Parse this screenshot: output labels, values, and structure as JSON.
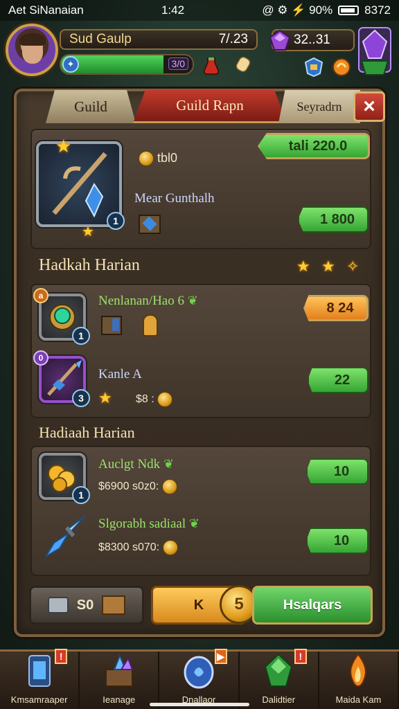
{
  "status_bar": {
    "left": "Aet SiNanaian",
    "time": "1:42",
    "right": "@ ⚙ ⚡ 90%",
    "extra": "8372"
  },
  "player": {
    "name": "Sud Gaulp",
    "score": "7/.23",
    "level": "3/0",
    "xp_percent": 78
  },
  "currency": {
    "gems": "32..31"
  },
  "tabs": {
    "guild": "Guild",
    "rank": "Guild Rapn",
    "third": "Seyradrn"
  },
  "close_icon": "×",
  "featured": {
    "coin_value": "tbl0",
    "item_name": "Mear Gunthalh",
    "badge": "1",
    "price_top": "tali  220.0",
    "price_bottom": "1 800"
  },
  "section1": {
    "title": "Hadkah Harian"
  },
  "row1": {
    "name": "Nenlanan/Hao 6",
    "badge_top": "a",
    "badge_bottom": "1",
    "price": "8 24"
  },
  "row2": {
    "name": "Kanle A",
    "cost": "$8 :",
    "badge_top": "0",
    "badge_bottom": "3",
    "price": "22"
  },
  "section2": {
    "title": "Hadiaah Harian"
  },
  "row3": {
    "name": "Auclgt Ndk",
    "cost": "$6900  s0z0:",
    "badge": "1",
    "price": "10"
  },
  "row4": {
    "name": "Slgorabh sadiaal",
    "cost": "$8300  s070:",
    "price": "10"
  },
  "buttons": {
    "grey": "S0",
    "gold": "K",
    "gold_coin": "5",
    "green": "Hsalqars"
  },
  "nav": [
    {
      "label": "Kmsamraaper",
      "icon": "lantern-icon",
      "alert": "!"
    },
    {
      "label": "Ieanage",
      "icon": "crystal-chest-icon",
      "alert": ""
    },
    {
      "label": "Dnallaor",
      "icon": "portal-icon",
      "alert": "▶"
    },
    {
      "label": "Dalidtier",
      "icon": "green-gem-icon",
      "alert": "!"
    },
    {
      "label": "Maida Kam",
      "icon": "flame-icon",
      "alert": ""
    }
  ],
  "colors": {
    "accent_green": "#36a534",
    "accent_orange": "#e2801c",
    "tab_red": "#c23a2c",
    "panel": "#3a2f23"
  }
}
